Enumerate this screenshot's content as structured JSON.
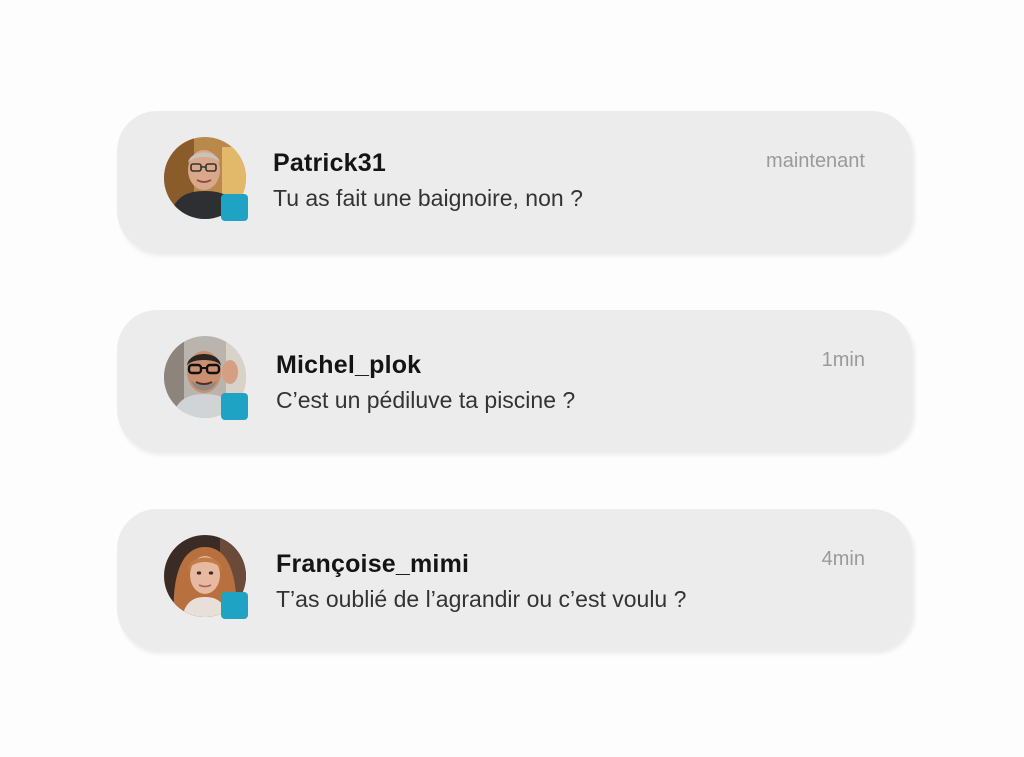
{
  "notifications": [
    {
      "sender": "Patrick31",
      "message": "Tu as fait une baignoire, non ?",
      "time": "maintenant",
      "avatar_icon": "avatar-man-glasses",
      "badge_color": "#1fa3c4"
    },
    {
      "sender": "Michel_plok",
      "message": "C’est un pédiluve ta piscine ?",
      "time": "1min",
      "avatar_icon": "avatar-man-beard-thumbs-up",
      "badge_color": "#1fa3c4"
    },
    {
      "sender": "Françoise_mimi",
      "message": "T’as oublié de l’agrandir ou c’est voulu ?",
      "time": "4min",
      "avatar_icon": "avatar-woman-red-hair",
      "badge_color": "#1fa3c4"
    }
  ],
  "colors": {
    "card_background": "#ececec",
    "page_background": "#fdfdfd",
    "badge": "#1fa3c4",
    "sender_text": "#141414",
    "message_text": "#333333",
    "time_text": "#9a9a9a"
  }
}
